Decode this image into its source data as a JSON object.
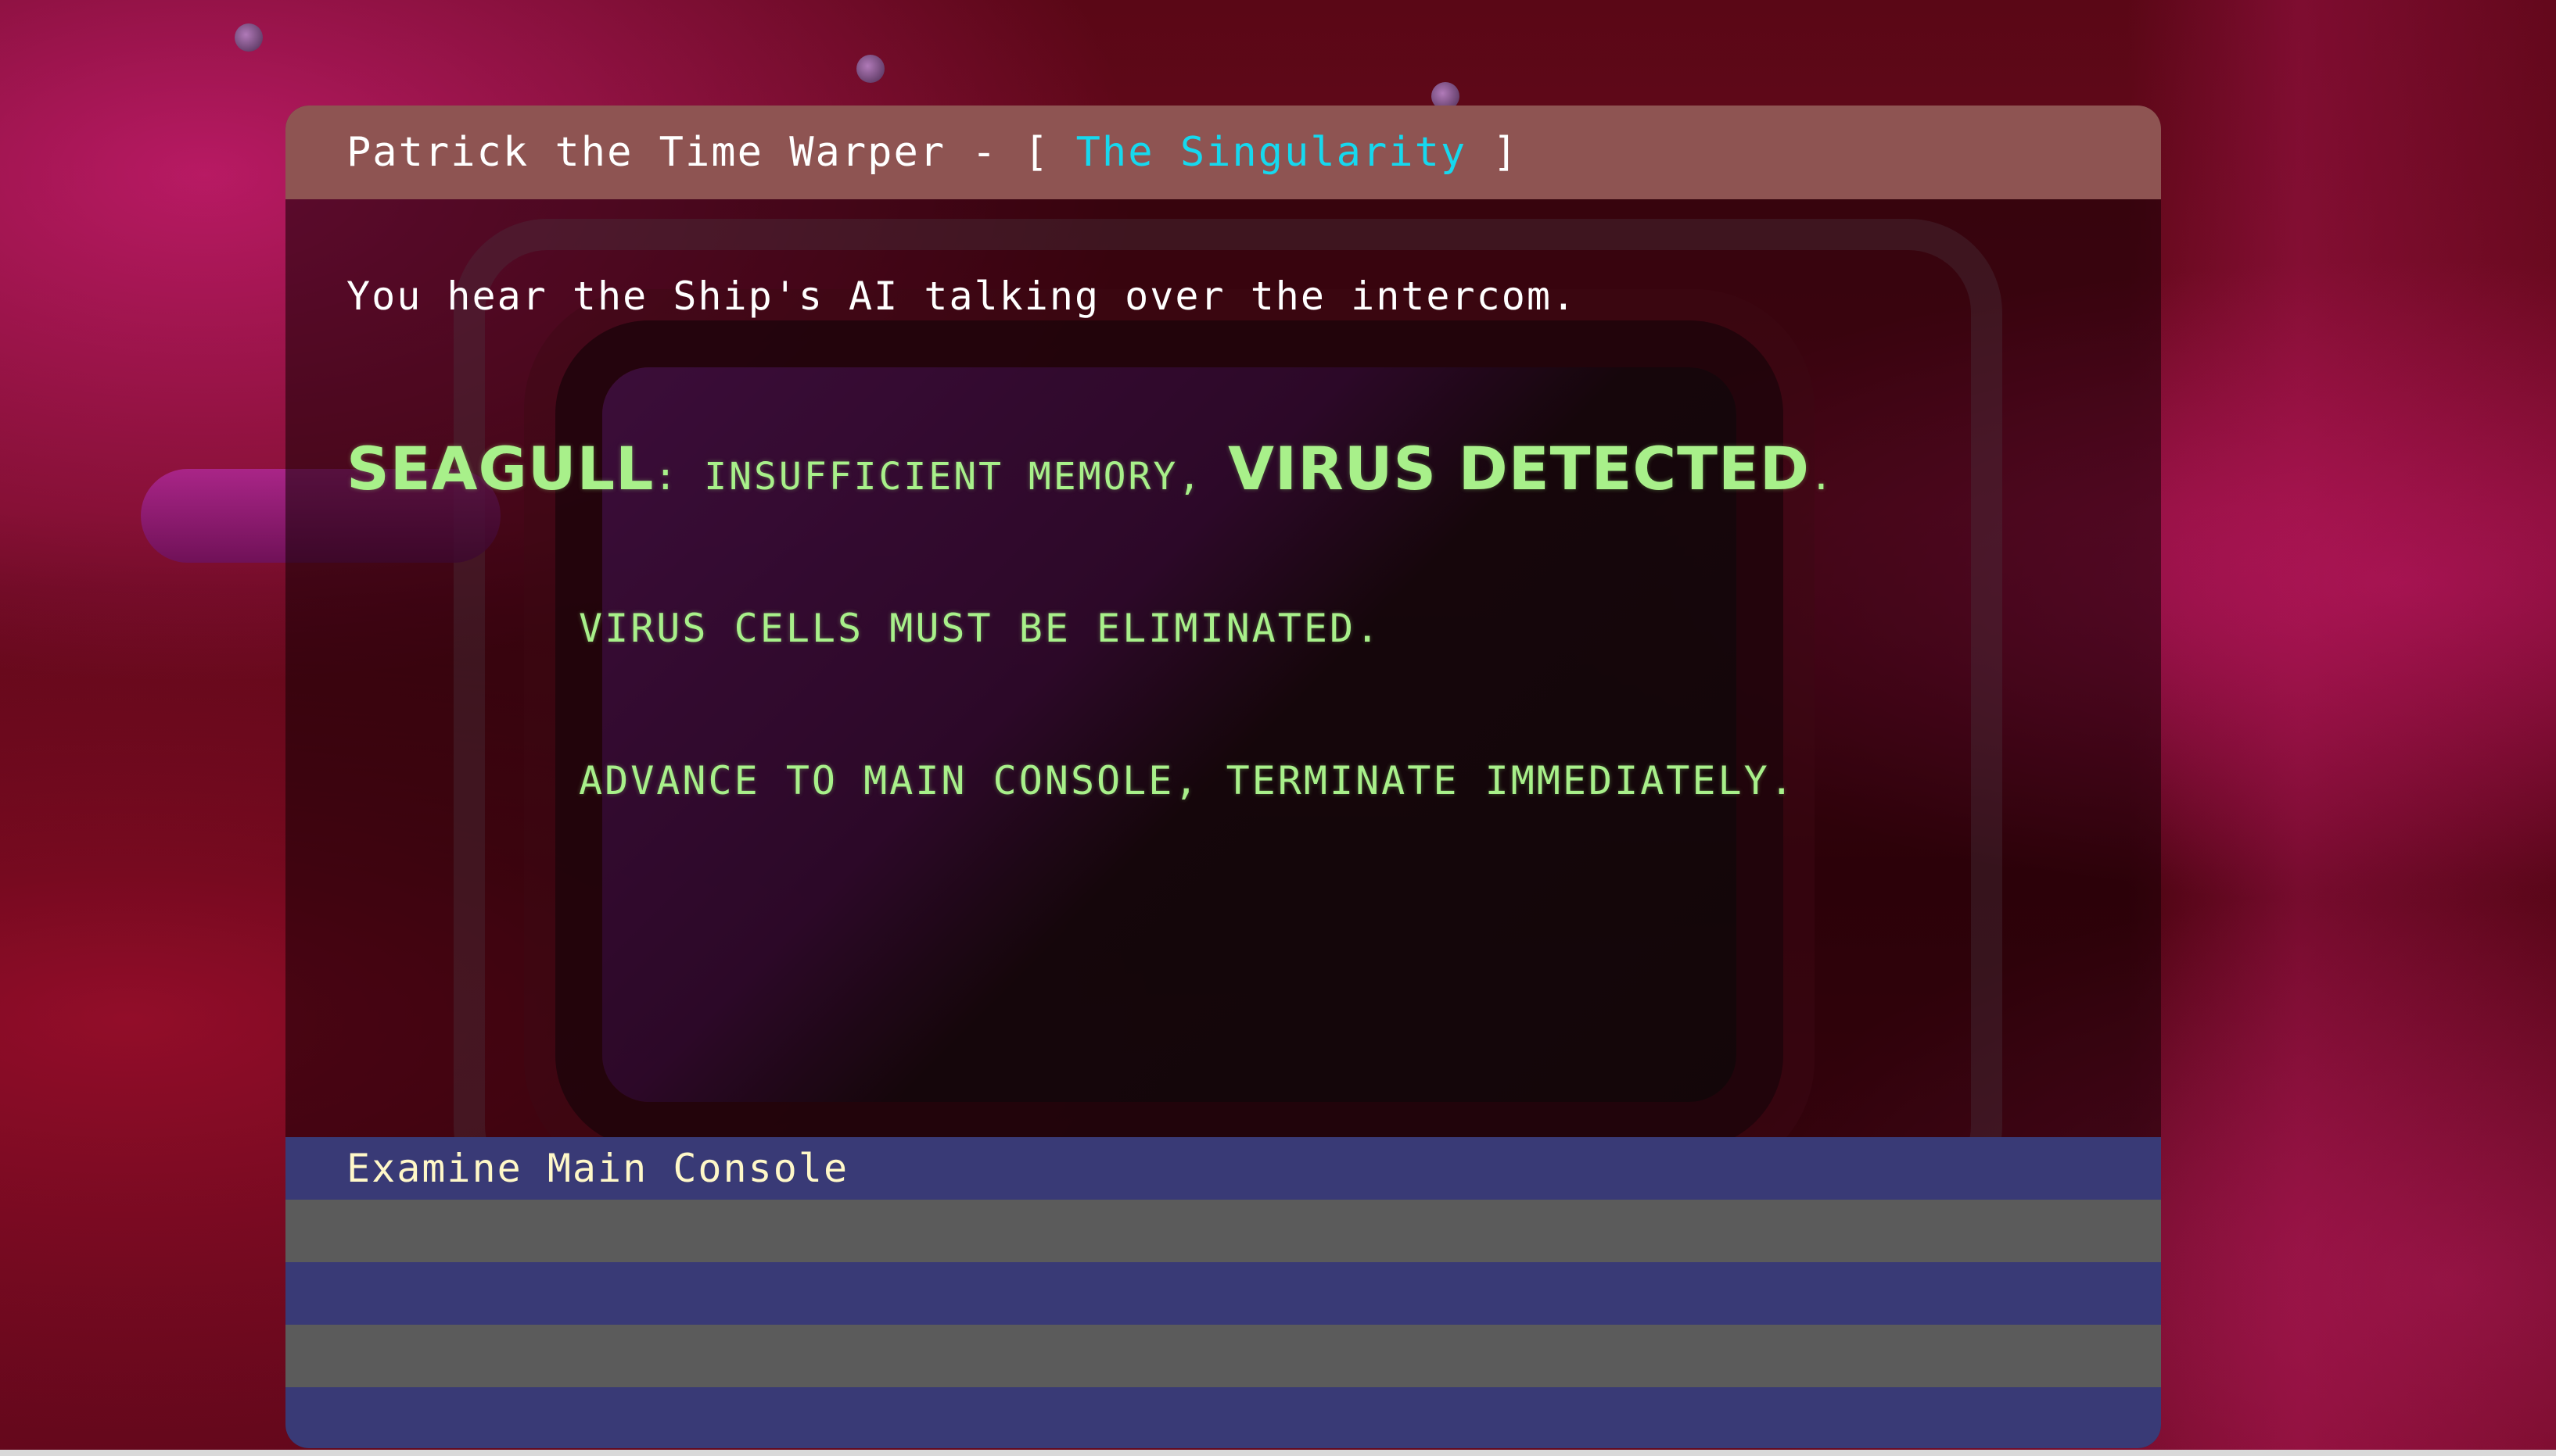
{
  "title_bar": {
    "prefix": "Patrick the Time Warper - [ ",
    "location": "The Singularity",
    "suffix": " ]"
  },
  "narration": "You hear the Ship's AI talking over the intercom.",
  "ai_message": {
    "speaker": "SEAGULL",
    "separator": ": ",
    "status_text": "INSUFFICIENT MEMORY, ",
    "alert": "VIRUS DETECTED",
    "alert_end": ".",
    "line_2": "VIRUS CELLS MUST BE ELIMINATED.",
    "line_3": "ADVANCE TO MAIN CONSOLE, TERMINATE IMMEDIATELY."
  },
  "choices": [
    {
      "label": "Examine Main Console"
    },
    {
      "label": ""
    },
    {
      "label": ""
    },
    {
      "label": ""
    },
    {
      "label": ""
    }
  ],
  "colors": {
    "title_bar_bg": "#8e5452",
    "location_text": "#16d8ee",
    "ai_text": "#a8f08a",
    "choice_row_a": "#393a76",
    "choice_row_b": "#5b5b5b",
    "choice_text": "#fff8c8"
  }
}
